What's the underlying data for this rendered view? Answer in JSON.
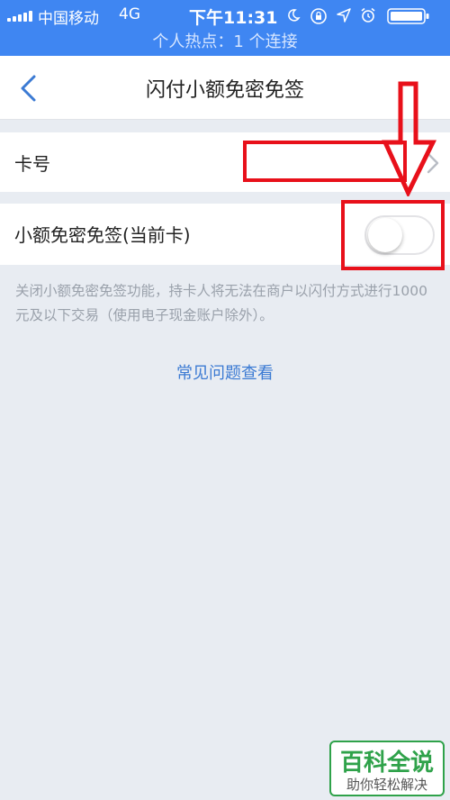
{
  "status_bar": {
    "carrier": "中国移动",
    "network": "4G",
    "time": "下午11:31",
    "icons": [
      "moon-icon",
      "rotation-lock-icon",
      "location-icon",
      "alarm-icon",
      "battery-icon"
    ],
    "hotspot_text": "个人热点：1 个连接",
    "background_color": "#3f86f2"
  },
  "nav": {
    "title": "闪付小额免密免签",
    "back_icon": "chevron-left-icon"
  },
  "rows": {
    "card_number_label": "卡号",
    "toggle_label": "小额免密免签(当前卡)",
    "toggle_state": "off"
  },
  "description": "关闭小额免密免签功能，持卡人将无法在商户以闪付方式进行1000元及以下交易（使用电子现金账户除外）。",
  "faq_link": "常见问题查看",
  "watermark": {
    "main": "百科全说",
    "sub": "助你轻松解决"
  },
  "annotation_color": "#e8101a"
}
